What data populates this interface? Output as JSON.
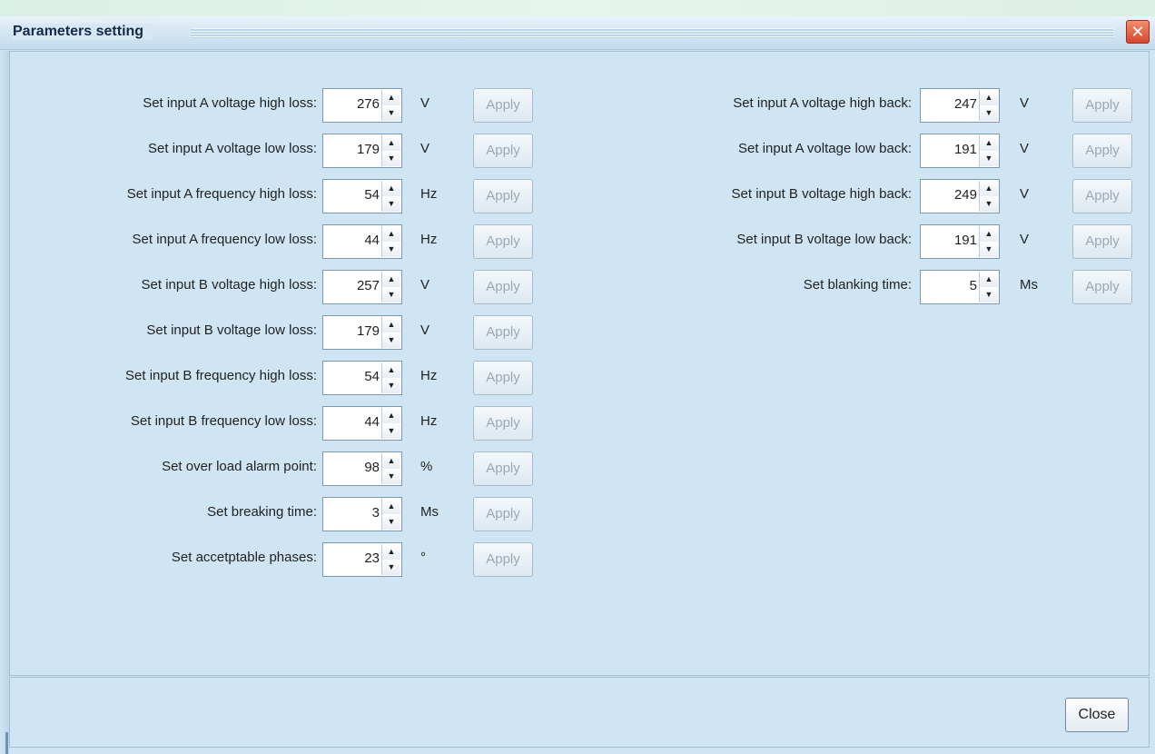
{
  "window": {
    "title": "Parameters setting",
    "close_glyph": "✕"
  },
  "spinner_icons": {
    "up": "▲",
    "down": "▼"
  },
  "apply_label": "Apply",
  "left_params": [
    {
      "label": "Set input A voltage high loss:",
      "value": "276",
      "unit": "V"
    },
    {
      "label": "Set input A voltage low loss:",
      "value": "179",
      "unit": "V"
    },
    {
      "label": "Set input A frequency high loss:",
      "value": "54",
      "unit": "Hz"
    },
    {
      "label": "Set input A frequency low loss:",
      "value": "44",
      "unit": "Hz"
    },
    {
      "label": "Set input B voltage high loss:",
      "value": "257",
      "unit": "V"
    },
    {
      "label": "Set input B voltage low loss:",
      "value": "179",
      "unit": "V"
    },
    {
      "label": "Set input B frequency high loss:",
      "value": "54",
      "unit": "Hz"
    },
    {
      "label": "Set input B frequency low loss:",
      "value": "44",
      "unit": "Hz"
    },
    {
      "label": "Set over load alarm point:",
      "value": "98",
      "unit": "%"
    },
    {
      "label": "Set breaking time:",
      "value": "3",
      "unit": "Ms"
    },
    {
      "label": "Set accetptable phases:",
      "value": "23",
      "unit": "°"
    }
  ],
  "right_params": [
    {
      "label": "Set input A voltage high back:",
      "value": "247",
      "unit": "V"
    },
    {
      "label": "Set input A voltage low back:",
      "value": "191",
      "unit": "V"
    },
    {
      "label": "Set input B voltage high back:",
      "value": "249",
      "unit": "V"
    },
    {
      "label": "Set input B voltage low back:",
      "value": "191",
      "unit": "V"
    },
    {
      "label": "Set blanking time:",
      "value": "5",
      "unit": "Ms"
    }
  ],
  "footer": {
    "close_label": "Close"
  }
}
